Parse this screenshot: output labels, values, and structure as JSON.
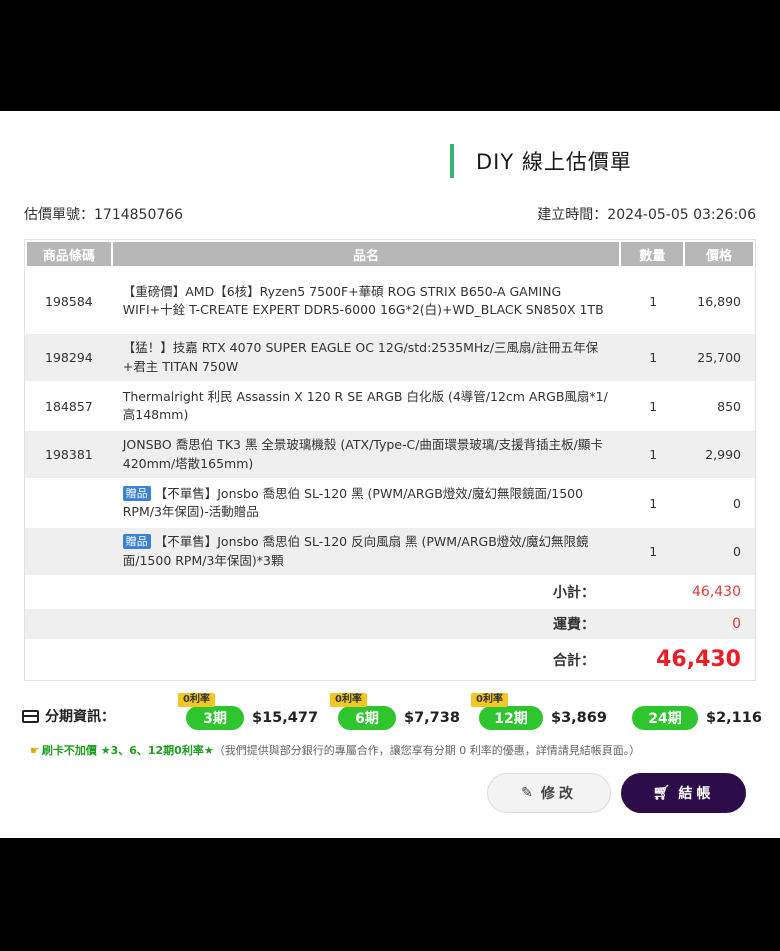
{
  "page_title": "DIY 線上估價單",
  "quote_no": "估價單號：1714850766",
  "created": "建立時間：2024-05-05 03:26:06",
  "columns": {
    "code": "商品條碼",
    "name": "品名",
    "qty": "數量",
    "price": "價格"
  },
  "items": [
    {
      "code": "198584",
      "name": "【重磅價】AMD【6核】Ryzen5 7500F+華碩 ROG STRIX B650-A GAMING WIFI+十銓 T-CREATE EXPERT DDR5-6000 16G*2(白)+WD_BLACK SN850X 1TB",
      "qty": "1",
      "price": "16,890"
    },
    {
      "code": "198294",
      "name": "【猛！】技嘉 RTX 4070 SUPER EAGLE OC 12G/std:2535MHz/三風扇/註冊五年保+君主 TITAN 750W",
      "qty": "1",
      "price": "25,700"
    },
    {
      "code": "184857",
      "name": "Thermalright 利民 Assassin X 120 R SE ARGB 白化版 (4導管/12cm ARGB風扇*1/高148mm)",
      "qty": "1",
      "price": "850"
    },
    {
      "code": "198381",
      "name": "JONSBO 喬思伯 TK3 黑 全景玻璃機殼 (ATX/Type-C/曲面環景玻璃/支援背插主板/顯卡420mm/塔散165mm)",
      "qty": "1",
      "price": "2,990"
    },
    {
      "code": "",
      "gift": "贈品",
      "name": "【不單售】Jonsbo 喬思伯 SL-120 黑 (PWM/ARGB燈效/魔幻無限鏡面/1500 RPM/3年保固)-活動贈品",
      "qty": "1",
      "price": "0"
    },
    {
      "code": "",
      "gift": "贈品",
      "name": "【不單售】Jonsbo 喬思伯 SL-120 反向風扇 黑 (PWM/ARGB燈效/魔幻無限鏡面/1500 RPM/3年保固)*3顆",
      "qty": "1",
      "price": "0"
    }
  ],
  "summary": {
    "subtotal_label": "小計：",
    "subtotal": "46,430",
    "shipping_label": "運費：",
    "shipping": "0",
    "total_label": "合計：",
    "total": "46,430"
  },
  "installment": {
    "label": "分期資訊：",
    "plans": [
      {
        "badge": "0利率",
        "term": "3期",
        "amount": "$15,477"
      },
      {
        "badge": "0利率",
        "term": "6期",
        "amount": "$7,738"
      },
      {
        "badge": "0利率",
        "term": "12期",
        "amount": "$3,869"
      },
      {
        "badge": "",
        "term": "24期",
        "amount": "$2,116"
      }
    ]
  },
  "promo": {
    "highlight": "刷卡不加價 ★3、6、12期0利率★",
    "note": "（我們提供與部分銀行的專屬合作，讓您享有分期 0 利率的優惠，詳情請見結帳頁面。）"
  },
  "buttons": {
    "edit": "修改",
    "checkout": "結帳"
  },
  "colors": {
    "accent_green": "#2fc52f",
    "price_red": "#ee1c25",
    "checkout_bg": "#2d0c4a",
    "badge_yellow": "#f2c623"
  }
}
